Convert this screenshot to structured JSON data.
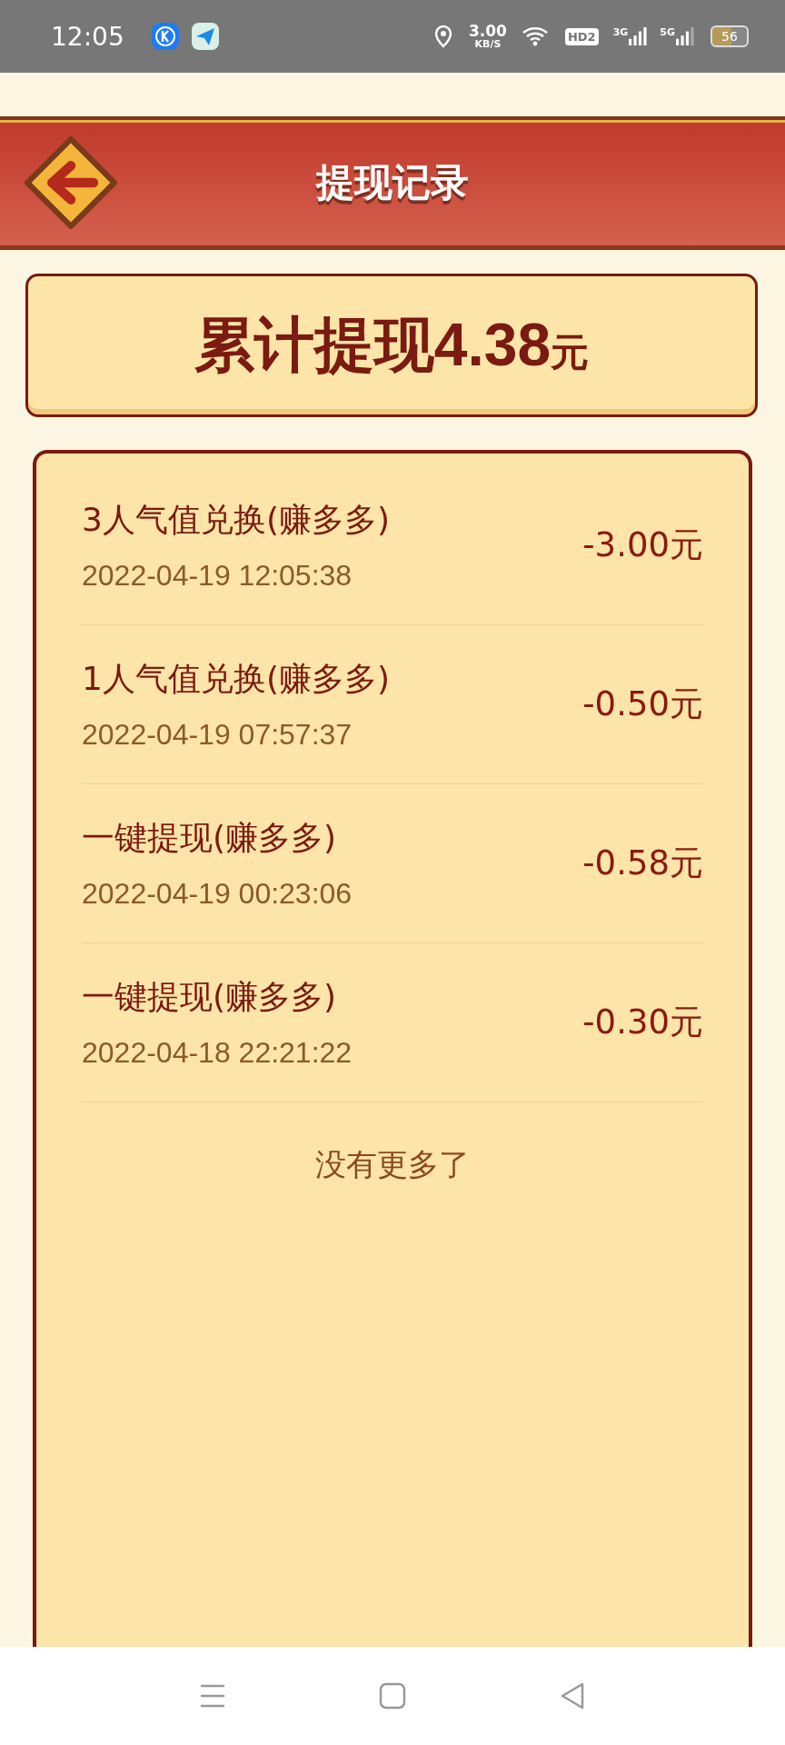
{
  "status_bar": {
    "time": "12:05",
    "speed_value": "3.00",
    "speed_unit": "KB/S",
    "hd_badge": "HD2",
    "network_1": "3G",
    "network_2": "5G",
    "battery": "56"
  },
  "header": {
    "title": "提现记录"
  },
  "total": {
    "label": "累计提现",
    "amount": "4.38",
    "unit": "元"
  },
  "records": [
    {
      "title": "3人气值兑换(赚多多)",
      "time": "2022-04-19 12:05:38",
      "amount": "-3.00元"
    },
    {
      "title": "1人气值兑换(赚多多)",
      "time": "2022-04-19 07:57:37",
      "amount": "-0.50元"
    },
    {
      "title": "一键提现(赚多多)",
      "time": "2022-04-19 00:23:06",
      "amount": "-0.58元"
    },
    {
      "title": "一键提现(赚多多)",
      "time": "2022-04-18 22:21:22",
      "amount": "-0.30元"
    }
  ],
  "end_note": "没有更多了"
}
